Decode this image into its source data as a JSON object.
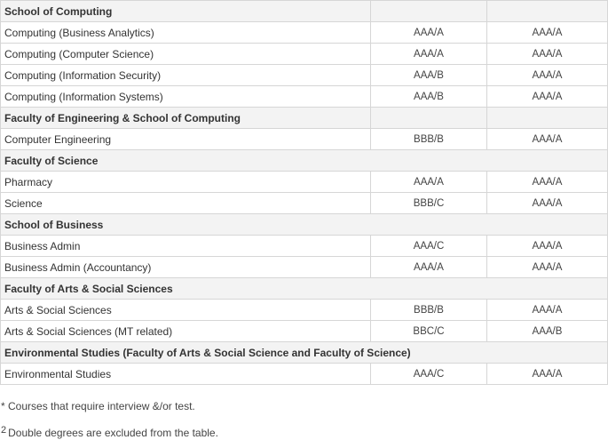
{
  "table": {
    "rows": [
      {
        "type": "section",
        "label": "School of Computing"
      },
      {
        "type": "course",
        "label": "Computing (Business Analytics)",
        "grade1": "AAA/A",
        "grade2": "AAA/A"
      },
      {
        "type": "course",
        "label": "Computing (Computer Science)",
        "grade1": "AAA/A",
        "grade2": "AAA/A"
      },
      {
        "type": "course",
        "label": "Computing (Information Security)",
        "grade1": "AAA/B",
        "grade2": "AAA/A"
      },
      {
        "type": "course",
        "label": "Computing (Information Systems)",
        "grade1": "AAA/B",
        "grade2": "AAA/A"
      },
      {
        "type": "section",
        "label": "Faculty of Engineering & School of Computing"
      },
      {
        "type": "course",
        "label": "Computer Engineering",
        "grade1": "BBB/B",
        "grade2": "AAA/A"
      },
      {
        "type": "section",
        "label": "Faculty of Science"
      },
      {
        "type": "course",
        "label": "Pharmacy",
        "grade1": "AAA/A",
        "grade2": "AAA/A"
      },
      {
        "type": "course",
        "label": "Science",
        "grade1": "BBB/C",
        "grade2": "AAA/A"
      },
      {
        "type": "section",
        "label": "School of Business"
      },
      {
        "type": "course",
        "label": "Business Admin",
        "grade1": "AAA/C",
        "grade2": "AAA/A"
      },
      {
        "type": "course",
        "label": "Business Admin (Accountancy)",
        "grade1": "AAA/A",
        "grade2": "AAA/A"
      },
      {
        "type": "section",
        "label": "Faculty of Arts & Social Sciences"
      },
      {
        "type": "course",
        "label": "Arts & Social Sciences",
        "grade1": "BBB/B",
        "grade2": "AAA/A"
      },
      {
        "type": "course",
        "label": "Arts & Social Sciences (MT related)",
        "grade1": "BBC/C",
        "grade2": "AAA/B"
      },
      {
        "type": "section",
        "label": "Environmental Studies (Faculty of Arts & Social Science and Faculty of Science)"
      },
      {
        "type": "course",
        "label": "Environmental Studies",
        "grade1": "AAA/C",
        "grade2": "AAA/A"
      }
    ]
  },
  "notes": {
    "note1": "* Courses that require interview &/or test.",
    "note2_marker": "2",
    "note2": "Double degrees are excluded from the table."
  }
}
